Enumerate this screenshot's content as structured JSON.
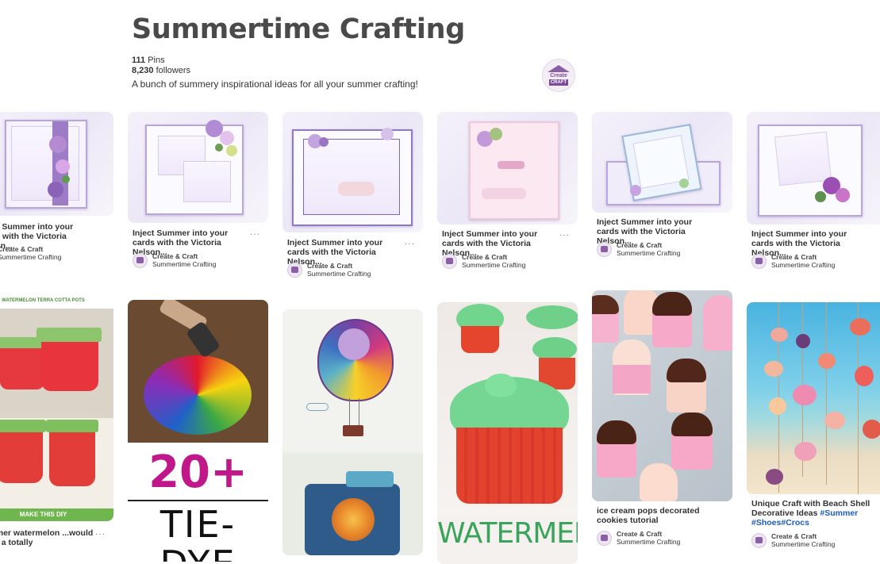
{
  "board": {
    "title": "Summertime Crafting",
    "pins_count": "111",
    "pins_label": "Pins",
    "followers_count": "8,230",
    "followers_label": "followers",
    "description": "A bunch of summery inspirational ideas for all your summer crafting!",
    "logo_line1": "Create",
    "logo_line2": "CRAFT"
  },
  "owner": {
    "name": "Create & Craft",
    "board": "Summertime Crafting"
  },
  "pins_row1": [
    {
      "caption": "Inject Summer into your cards with the Victoria Nelson..."
    },
    {
      "caption": "Inject Summer into your cards with the Victoria Nelson..."
    },
    {
      "caption": "Inject Summer into your cards with the Victoria Nelson..."
    },
    {
      "caption": "Inject Summer into your cards with the Victoria Nelson..."
    },
    {
      "caption": "Inject Summer into your cards with the Victoria Nelson..."
    },
    {
      "caption": "Inject Summer into your cards with the Victoria Nelson..."
    }
  ],
  "pins_row2": [
    {
      "caption": "Summer watermelon ...would make a totally",
      "image_header": "WATERMELON TERRA COTTA POTS",
      "image_footer": "MAKE THIS DIY"
    },
    {
      "image_text": "20+",
      "image_text2": "TIE-DYE"
    },
    {},
    {
      "image_text": "WATERMELON"
    },
    {
      "caption": "ice cream pops decorated cookies tutorial"
    },
    {
      "caption_plain": "Unique Craft with Beach Shell Decorative Ideas",
      "tags": [
        "#Summer",
        "#Shoes",
        "#Crocs"
      ]
    }
  ],
  "more_label": "..."
}
